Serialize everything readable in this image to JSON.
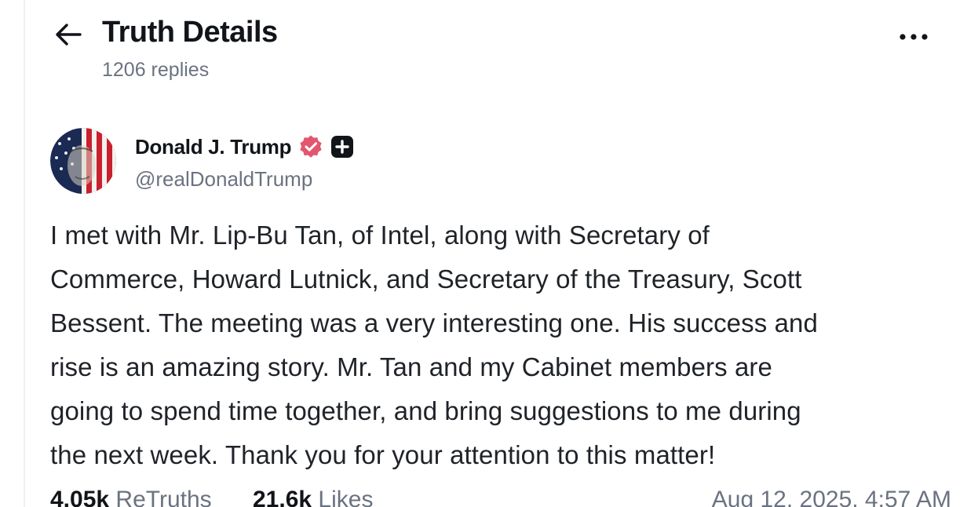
{
  "header": {
    "title": "Truth Details",
    "reply_count": "1206 replies",
    "back_icon": "arrow-left-icon",
    "more_icon": "ellipsis-icon"
  },
  "post": {
    "author": {
      "display_name": "Donald J. Trump",
      "handle": "@realDonaldTrump",
      "verified_icon": "verified-badge-icon",
      "verified_color": "#e2576f",
      "plus_icon": "plus-badge-icon"
    },
    "lines": [
      "I met with Mr. Lip-Bu Tan, of Intel, along with Secretary of",
      "Commerce, Howard Lutnick, and Secretary of the Treasury, Scott",
      "Bessent. The meeting was a very interesting one. His success and",
      "rise is an amazing story. Mr. Tan and my Cabinet members are",
      "going to spend time together, and bring suggestions to me during",
      "the next week. Thank you for your attention to this matter!"
    ],
    "stats": {
      "retruths_count": "4.05k",
      "retruths_label": "ReTruths",
      "likes_count": "21.6k",
      "likes_label": "Likes",
      "timestamp": "Aug 12, 2025, 4:57 AM"
    }
  }
}
